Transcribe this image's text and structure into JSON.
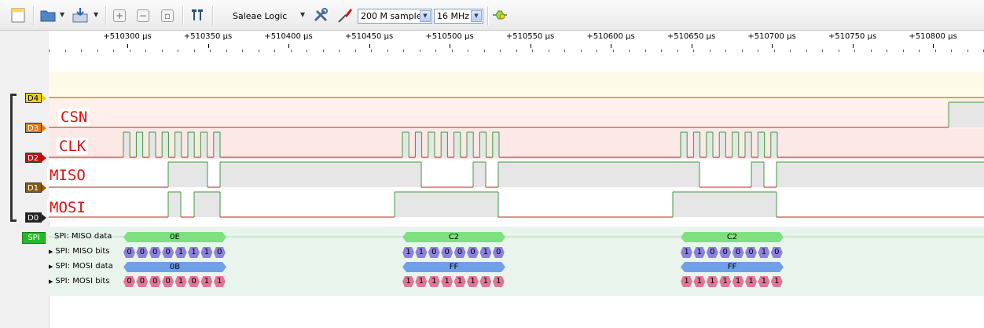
{
  "toolbar": {
    "device": "Saleae Logic",
    "samples": "200 M samples",
    "rate": "16 MHz",
    "icons": [
      "new-file-icon",
      "open-folder-icon",
      "save-icon",
      "zoom-in-icon",
      "zoom-out-icon",
      "zoom-fit-icon",
      "split-cursor-icon",
      "tools-icon",
      "probe-icon",
      "analyzer-icon"
    ]
  },
  "ruler": {
    "ticks": [
      "+510300 µs",
      "+510350 µs",
      "+510400 µs",
      "+510450 µs",
      "+510500 µs",
      "+510550 µs",
      "+510600 µs",
      "+510650 µs",
      "+510700 µs",
      "+510750 µs",
      "+510800 µs"
    ]
  },
  "channels": [
    {
      "tag": "D4",
      "name": "",
      "color": "#e8d21a"
    },
    {
      "tag": "D3",
      "name": "CSN",
      "color": "#e87a1a"
    },
    {
      "tag": "D2",
      "name": "CLK",
      "color": "#c81010"
    },
    {
      "tag": "D1",
      "name": "MISO",
      "color": "#8a5a14"
    },
    {
      "tag": "D0",
      "name": "MOSI",
      "color": "#222222"
    }
  ],
  "analyzer": {
    "tag": "SPI",
    "rows": [
      {
        "label": "SPI: MISO data",
        "expandable": false
      },
      {
        "label": "SPI: MISO bits",
        "expandable": true
      },
      {
        "label": "SPI: MOSI data",
        "expandable": true
      },
      {
        "label": "SPI: MOSI bits",
        "expandable": true
      }
    ],
    "frames": [
      {
        "miso_data": "0E",
        "miso_bits": [
          "0",
          "0",
          "0",
          "0",
          "1",
          "1",
          "1",
          "0"
        ],
        "mosi_data": "0B",
        "mosi_bits": [
          "0",
          "0",
          "0",
          "0",
          "1",
          "0",
          "1",
          "1"
        ]
      },
      {
        "miso_data": "C2",
        "miso_bits": [
          "1",
          "1",
          "0",
          "0",
          "0",
          "0",
          "1",
          "0"
        ],
        "mosi_data": "FF",
        "mosi_bits": [
          "1",
          "1",
          "1",
          "1",
          "1",
          "1",
          "1",
          "1"
        ]
      },
      {
        "miso_data": "C2",
        "miso_bits": [
          "1",
          "1",
          "0",
          "0",
          "0",
          "0",
          "1",
          "0"
        ],
        "mosi_data": "FF",
        "mosi_bits": [
          "1",
          "1",
          "1",
          "1",
          "1",
          "1",
          "1",
          "1"
        ]
      }
    ]
  },
  "colors": {
    "miso_data": "#7ee07e",
    "miso_bits": "#8c80e0",
    "mosi_data": "#6fa0e8",
    "mosi_bits": "#e07598"
  }
}
